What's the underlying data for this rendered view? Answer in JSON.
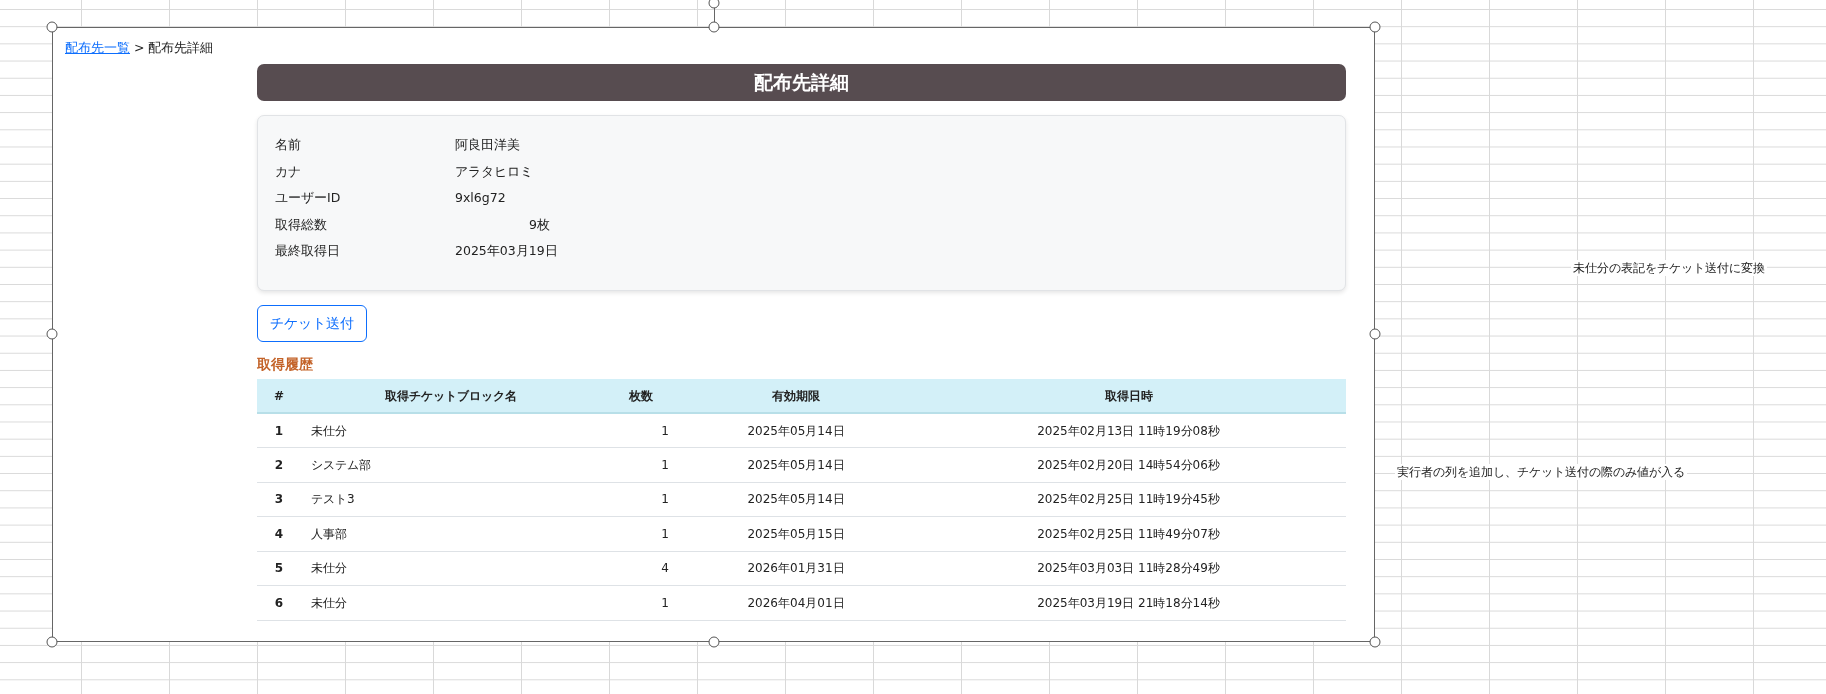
{
  "breadcrumb": {
    "link": "配布先一覧",
    "separator": ">",
    "current": "配布先詳細"
  },
  "title": "配布先詳細",
  "details": [
    {
      "kind": "text",
      "label": "名前",
      "value": "阿良田洋美"
    },
    {
      "kind": "text",
      "label": "カナ",
      "value": "アラタヒロミ"
    },
    {
      "kind": "text",
      "label": "ユーザーID",
      "value": "9xl6g72"
    },
    {
      "kind": "count",
      "label": "取得総数",
      "value": "9枚"
    },
    {
      "kind": "text",
      "label": "最終取得日",
      "value": "2025年03月19日"
    }
  ],
  "send_button": "チケット送付",
  "history": {
    "heading": "取得履歴",
    "columns": [
      "#",
      "取得チケットブロック名",
      "枚数",
      "有効期限",
      "取得日時"
    ],
    "rows": [
      [
        "1",
        "未仕分",
        "1",
        "2025年05月14日",
        "2025年02月13日 11時19分08秒"
      ],
      [
        "2",
        "システム部",
        "1",
        "2025年05月14日",
        "2025年02月20日 14時54分06秒"
      ],
      [
        "3",
        "テスト3",
        "1",
        "2025年05月14日",
        "2025年02月25日 11時19分45秒"
      ],
      [
        "4",
        "人事部",
        "1",
        "2025年05月15日",
        "2025年02月25日 11時49分07秒"
      ],
      [
        "5",
        "未仕分",
        "4",
        "2026年01月31日",
        "2025年03月03日 11時28分49秒"
      ],
      [
        "6",
        "未仕分",
        "1",
        "2026年04月01日",
        "2025年03月19日 21時18分14秒"
      ]
    ]
  },
  "sheet_notes": [
    {
      "text": "未仕分の表記をチケット送付に変換"
    },
    {
      "text": "実行者の列を追加し、チケット送付の際のみ値が入る"
    }
  ]
}
